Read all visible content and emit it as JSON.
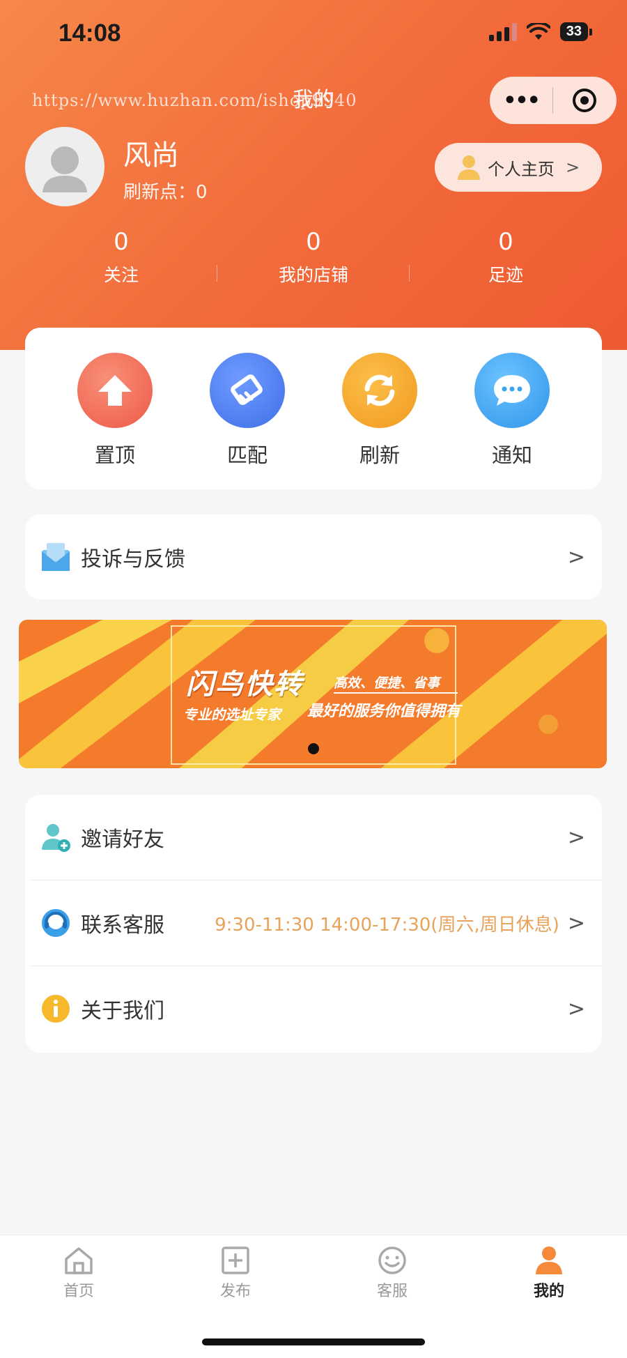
{
  "status_bar": {
    "time": "14:08",
    "battery": "33"
  },
  "header": {
    "watermark": "https://www.huzhan.com/ishop9940",
    "title": "我的",
    "capsule_more": "•••"
  },
  "profile": {
    "name": "风尚",
    "points": "刷新点：0",
    "homepage_button": "个人主页",
    "homepage_chevron": ">"
  },
  "stats": [
    {
      "value": "0",
      "label": "关注"
    },
    {
      "value": "0",
      "label": "我的店铺"
    },
    {
      "value": "0",
      "label": "足迹"
    }
  ],
  "quick_actions": [
    {
      "label": "置顶",
      "icon": "arrow-up-icon",
      "color": "#f06a56"
    },
    {
      "label": "匹配",
      "icon": "handshake-icon",
      "color": "#4e7ef5"
    },
    {
      "label": "刷新",
      "icon": "refresh-icon",
      "color": "#f6a32b"
    },
    {
      "label": "通知",
      "icon": "chat-bubble-icon",
      "color": "#3aa4ee"
    }
  ],
  "feedback": {
    "label": "投诉与反馈",
    "chevron": ">"
  },
  "banner": {
    "title": "闪鸟快转",
    "tagline": "高效、便捷、省事",
    "subtitle_left": "专业的选址专家",
    "subtitle_right": "最好的服务你值得拥有"
  },
  "menu": [
    {
      "label": "邀请好友",
      "extra": "",
      "icon": "invite-friend-icon",
      "chevron": ">"
    },
    {
      "label": "联系客服",
      "extra": "9:30-11:30 14:00-17:30(周六,周日休息)",
      "icon": "customer-service-icon",
      "chevron": ">"
    },
    {
      "label": "关于我们",
      "extra": "",
      "icon": "info-icon",
      "chevron": ">"
    }
  ],
  "tabbar": [
    {
      "label": "首页",
      "icon": "home-icon",
      "active": false
    },
    {
      "label": "发布",
      "icon": "publish-icon",
      "active": false
    },
    {
      "label": "客服",
      "icon": "service-icon",
      "active": false
    },
    {
      "label": "我的",
      "icon": "profile-icon",
      "active": true
    }
  ],
  "colors": {
    "brand": "#f26a3a",
    "accent_text": "#e8a25a",
    "background": "#f6f6f6"
  }
}
